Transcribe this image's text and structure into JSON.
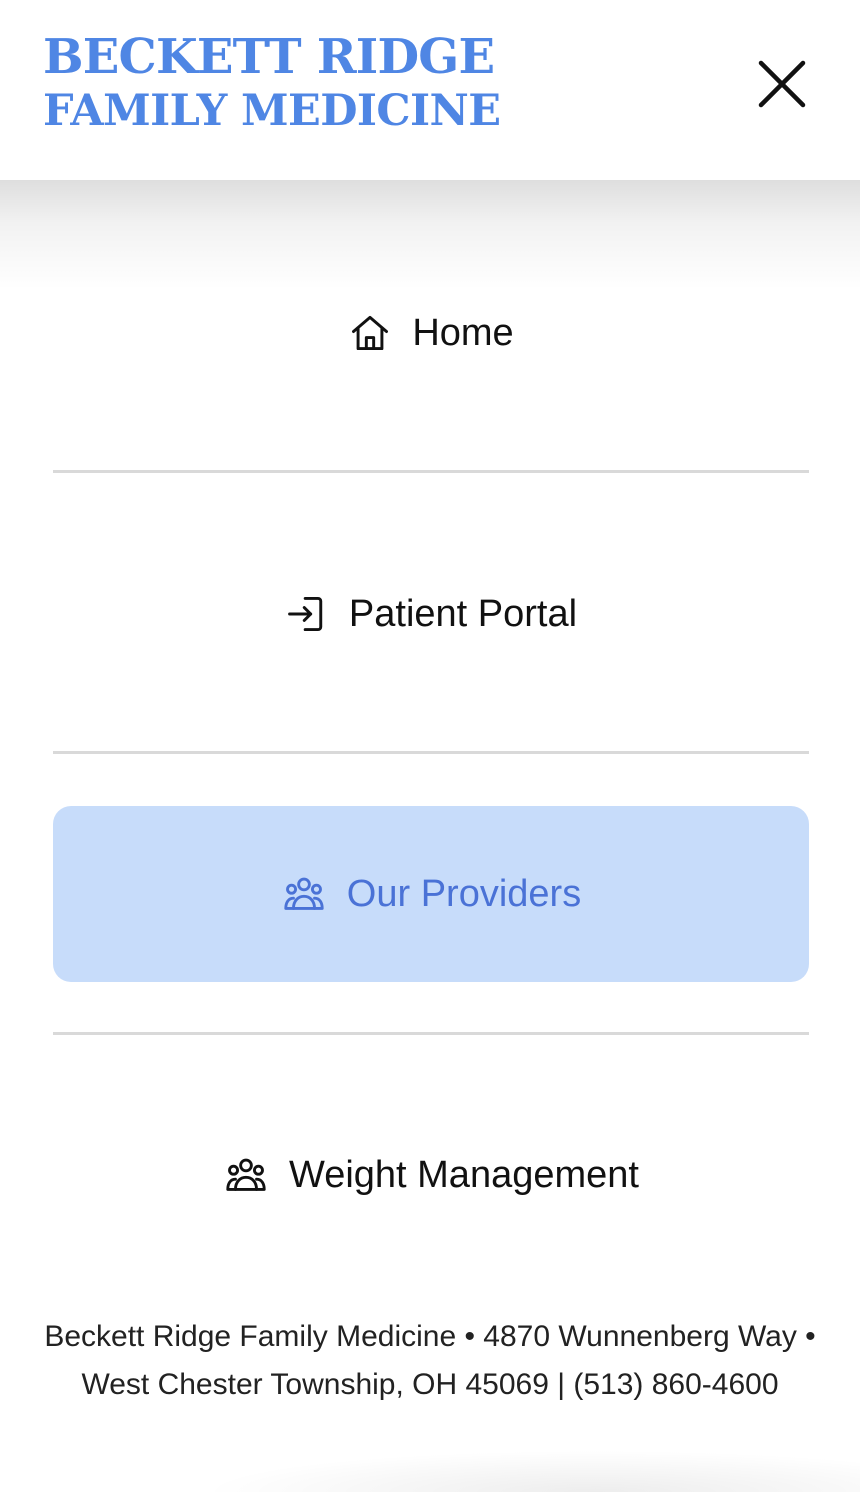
{
  "header": {
    "logo_line1": "BECKETT RIDGE",
    "logo_line2": "FAMILY MEDICINE",
    "close_icon": "close-icon"
  },
  "menu": {
    "items": [
      {
        "label": "Home",
        "icon": "home-icon",
        "active": false
      },
      {
        "label": "Patient Portal",
        "icon": "login-icon",
        "active": false
      },
      {
        "label": "Our Providers",
        "icon": "users-icon",
        "active": true
      },
      {
        "label": "Weight Management",
        "icon": "users-icon",
        "active": false
      }
    ]
  },
  "footer": {
    "text": "Beckett Ridge Family Medicine • 4870 Wunnenberg Way • West Chester Township, OH 45069 | (513) 860-4600"
  },
  "colors": {
    "brand_blue": "#4f86e4",
    "active_bg": "#c7dcfa",
    "active_text": "#4a72d6",
    "divider": "#d9d9d9"
  }
}
